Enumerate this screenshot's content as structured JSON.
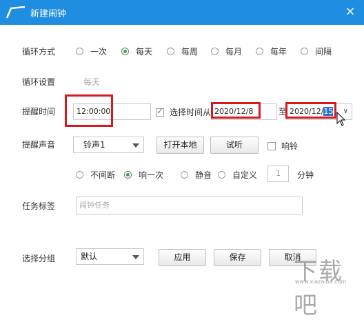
{
  "window": {
    "title": "新建闹钟",
    "close_glyph": "×"
  },
  "repeat": {
    "label": "循环方式",
    "options": [
      "一次",
      "每天",
      "每周",
      "每月",
      "每年",
      "间隔"
    ],
    "selected": "每天"
  },
  "repeat_setting": {
    "label": "循环设置",
    "value": "每天"
  },
  "reminder_time": {
    "label": "提醒时间",
    "time_value": "12:00:00",
    "select_range_label": "选择时间从",
    "select_range_checked": true,
    "from_date": "2020/12/8",
    "to_label": "至",
    "to_date_prefix": "2020/12/",
    "to_date_day": "15"
  },
  "sound": {
    "label": "提醒声音",
    "ringtone": "铃声1",
    "open_local": "打开本地",
    "listen": "试听",
    "ring_label": "响铃",
    "ring_checked": false,
    "play_options": [
      "不间断",
      "响一次",
      "静音",
      "自定义"
    ],
    "play_selected": "响一次",
    "custom_value": "1",
    "custom_unit": "分钟"
  },
  "task": {
    "label": "任务标签",
    "placeholder": "闹钟任务"
  },
  "group": {
    "label": "选择分组",
    "value": "默认",
    "apply": "应用",
    "save": "保存",
    "cancel": "取消"
  },
  "watermark": {
    "text": "下载吧",
    "sub": "www.xiazaiba.com"
  },
  "colors": {
    "titlebar": "#1f8ee0",
    "radio_selected": "#2ea84a",
    "highlight_box": "#d8181d"
  }
}
